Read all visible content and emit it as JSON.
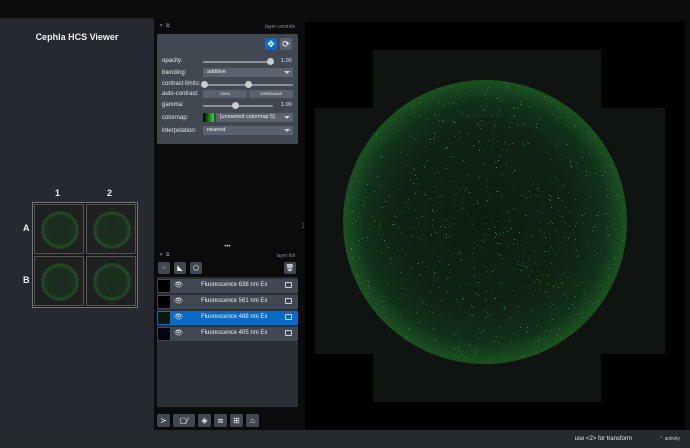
{
  "app": {
    "title": "Cephla HCS Viewer"
  },
  "plate": {
    "columns": [
      "1",
      "2"
    ],
    "rows": [
      "A",
      "B"
    ]
  },
  "layer_controls": {
    "header": "layer controls",
    "opacity": {
      "label": "opacity:",
      "value": "1.00",
      "level": 1.0
    },
    "blending": {
      "label": "blending:",
      "value": "additive"
    },
    "contrast_limits": {
      "label": "contrast limits:"
    },
    "auto_contrast": {
      "label": "auto-contrast:",
      "once": "once",
      "continuous": "continuous"
    },
    "gamma": {
      "label": "gamma:",
      "value": "1.00",
      "level": 0.5
    },
    "colormap": {
      "label": "colormap:",
      "value": "[unnamed colormap 5]"
    },
    "interpolation": {
      "label": "interpolation:",
      "value": "nearest"
    }
  },
  "layer_list": {
    "header": "layer list",
    "layers": [
      {
        "name": "Fluorescence 638 nm Ex",
        "selected": false
      },
      {
        "name": "Fluorescence 561 nm Ex",
        "selected": false
      },
      {
        "name": "Fluorescence 488 nm Ex",
        "selected": true
      },
      {
        "name": "Fluorescence 405 nm Ex",
        "selected": false
      }
    ]
  },
  "status": {
    "hint": "use <2> for transform",
    "activity": "activity"
  },
  "colors": {
    "accent": "#0a6ac8",
    "panel": "#414851",
    "fluorescence": "#3fa33f"
  },
  "icons": [
    "move-icon",
    "transform-icon",
    "points-layer-icon",
    "shapes-layer-icon",
    "labels-layer-icon",
    "delete-icon",
    "eye-icon",
    "image-icon",
    "console-icon",
    "ndisplay-icon",
    "roll-icon",
    "transpose-icon",
    "grid-icon",
    "home-icon"
  ]
}
